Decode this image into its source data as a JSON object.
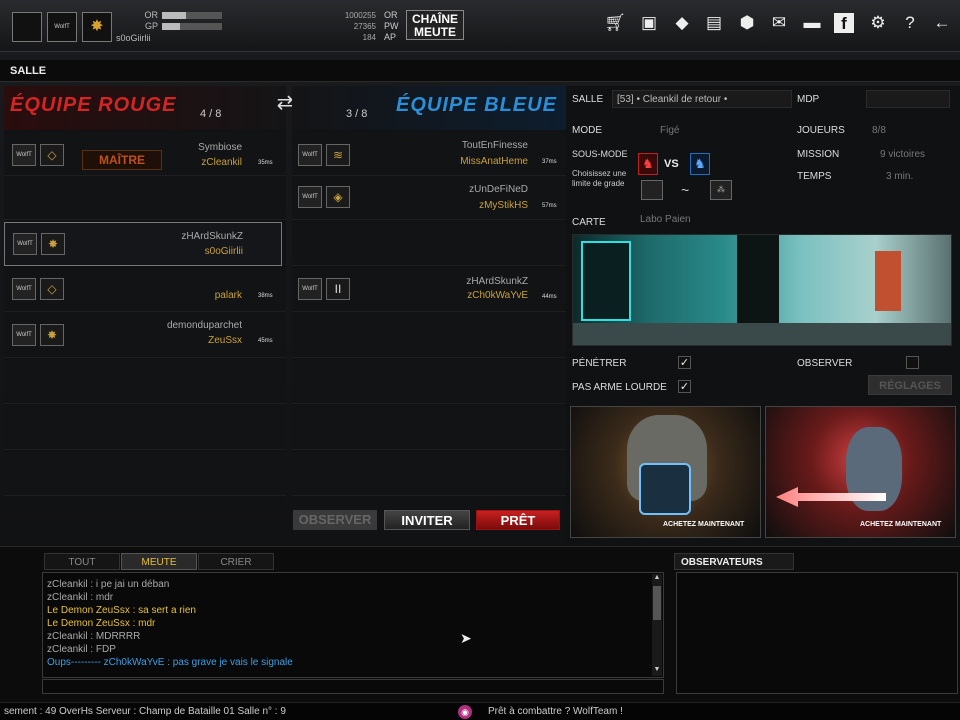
{
  "player": {
    "name": "s0oGiirlii",
    "stats": [
      {
        "label": "OR",
        "fill": 0.4
      },
      {
        "label": "GP",
        "fill": 0.3
      },
      {
        "label": "AP",
        "fill": 0.0
      }
    ],
    "currency": [
      {
        "value": "1000255",
        "label": "OR"
      },
      {
        "value": "27365",
        "label": "PW"
      },
      {
        "value": "184",
        "label": "AP"
      }
    ]
  },
  "chaine": {
    "line1": "CHAÎNE",
    "line2": "MEUTE"
  },
  "top_icons": [
    "cart-icon",
    "bag-icon",
    "wolf-icon",
    "book-icon",
    "cube-icon",
    "mail-icon",
    "folder-icon",
    "facebook-icon",
    "gear-icon",
    "help-icon",
    "back-arrow-icon"
  ],
  "section_title": "SALLE",
  "red_team": {
    "title": "ÉQUIPE ROUGE",
    "count": "4 / 8",
    "master_label": "MAÎTRE",
    "players": [
      {
        "name": "Symbiose",
        "clan": "zCleankil",
        "ping": "35ms",
        "badge": "◇",
        "selected": false,
        "master": true
      },
      {
        "name": "",
        "clan": "",
        "ping": "",
        "badge": "",
        "empty": true
      },
      {
        "name": "zHArdSkunkZ",
        "clan": "s0oGiirlii",
        "ping": "",
        "badge": "✸",
        "selected": true
      },
      {
        "name": "",
        "clan": "palark",
        "ping": "38ms",
        "badge": "◇"
      },
      {
        "name": "demonduparchet",
        "clan": "ZeuSsx",
        "ping": "45ms",
        "badge": "✸"
      }
    ]
  },
  "blue_team": {
    "title": "ÉQUIPE BLEUE",
    "count": "3 / 8",
    "players": [
      {
        "name": "ToutEnFinesse",
        "clan": "MissAnatHeme",
        "ping": "37ms",
        "badge": "≋"
      },
      {
        "name": "zUnDeFiNeD",
        "clan": "zMyStikHS",
        "ping": "57ms",
        "badge": "◈"
      },
      {
        "name": "",
        "clan": "",
        "ping": "",
        "empty": true
      },
      {
        "name": "zHArdSkunkZ",
        "clan": "zCh0kWaYvE",
        "ping": "44ms",
        "badge": "II"
      }
    ]
  },
  "buttons": {
    "observe": "OBSERVER",
    "invite": "INVITER",
    "ready": "PRÊT",
    "settings": "RÉGLAGES"
  },
  "room": {
    "salle_label": "SALLE",
    "salle_value": "[53] • Cleankil de retour •",
    "mdp_label": "MDP",
    "mode_label": "MODE",
    "mode_value": "Figé",
    "joueurs_label": "JOUEURS",
    "joueurs_value": "8/8",
    "sousmode_label": "SOUS-MODE",
    "vs": "VS",
    "grade_text": "Choisissez une limite de grade",
    "tilde": "~",
    "mission_label": "MISSION",
    "mission_value": "9 victoires",
    "temps_label": "TEMPS",
    "temps_value": "3 min.",
    "carte_label": "CARTE",
    "carte_value": "Labo Paien",
    "penetrer_label": "PÉNÉTRER",
    "pas_arme_label": "PAS ARME LOURDE",
    "observer_label": "OBSERVER"
  },
  "ads": [
    {
      "label": "ACHETEZ MAINTENANT"
    },
    {
      "label": "ACHETEZ MAINTENANT"
    }
  ],
  "chat": {
    "tabs": [
      "TOUT",
      "MEUTE",
      "CRIER"
    ],
    "active_tab": 1,
    "lines": [
      {
        "text": "zCleankil : i pe jai un déban",
        "color": "#aaa"
      },
      {
        "text": "zCleankil : mdr",
        "color": "#aaa"
      },
      {
        "text": "Le Demon     ZeuSsx : sa sert a rien",
        "color": "#e6c13a"
      },
      {
        "text": "Le Demon     ZeuSsx : mdr",
        "color": "#e6c13a"
      },
      {
        "text": "zCleankil : MDRRRR",
        "color": "#aaa"
      },
      {
        "text": "zCleankil : FDP",
        "color": "#aaa"
      },
      {
        "text": "Oups---------  zCh0kWaYvE : pas grave je vais le signale",
        "color": "#3b9fe8"
      }
    ]
  },
  "observers_title": "OBSERVATEURS",
  "status": {
    "left": "sement : 49 OverHs Serveur : Champ de Bataille 01 Salle n° : 9",
    "right": "Prêt à combattre ? WolfTeam !"
  }
}
